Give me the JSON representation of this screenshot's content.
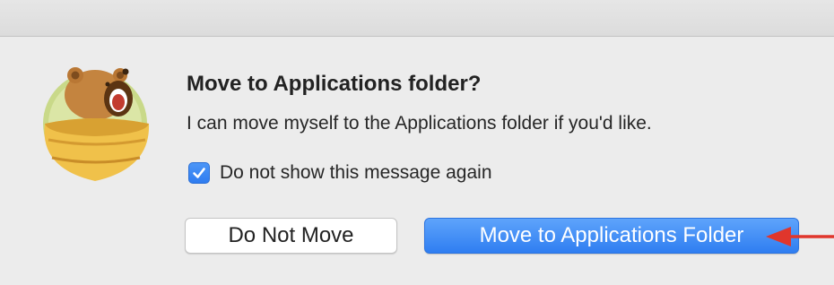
{
  "dialog": {
    "title": "Move to Applications folder?",
    "message": "I can move myself to the Applications folder if you'd like.",
    "checkbox": {
      "label": "Do not show this message again",
      "checked": true
    },
    "buttons": {
      "secondary_label": "Do Not Move",
      "primary_label": "Move to Applications Folder"
    }
  },
  "icons": {
    "app_icon": "tunnelbear-icon",
    "checkbox_check": "checkmark-icon",
    "annotation": "red-arrow-pointer"
  },
  "colors": {
    "accent": "#2f7ef1",
    "annotation_arrow": "#e0362c",
    "background": "#ececec"
  }
}
